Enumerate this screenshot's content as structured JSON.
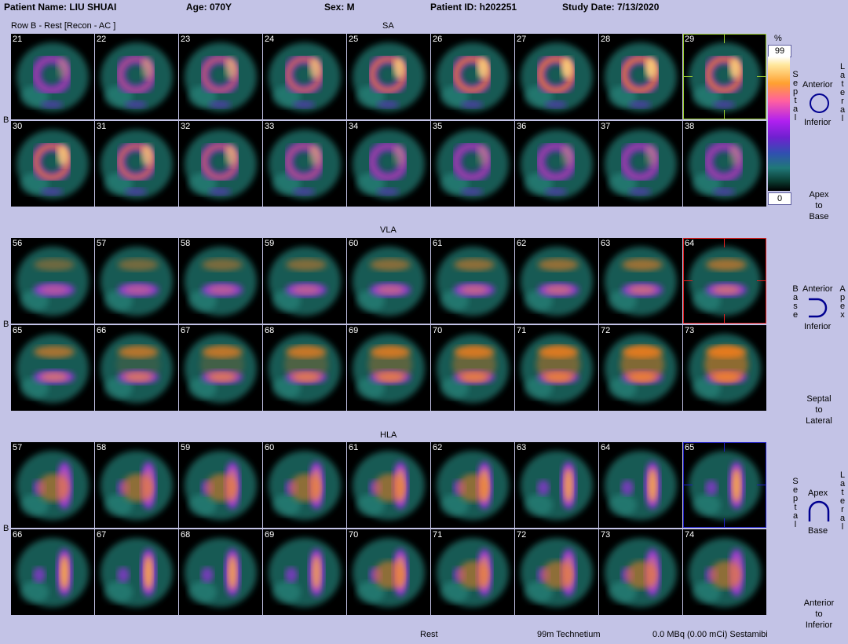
{
  "header": {
    "patient_name": "Patient Name: LIU SHUAI",
    "age": "Age: 070Y",
    "sex": "Sex: M",
    "patient_id": "Patient ID: h202251",
    "study_date": "Study Date: 7/13/2020"
  },
  "row_label": "Row B - Rest [Recon - AC ]",
  "side_label": "B",
  "sections": [
    {
      "title": "SA",
      "rows": [
        [
          "21",
          "22",
          "23",
          "24",
          "25",
          "26",
          "27",
          "28",
          "29"
        ],
        [
          "30",
          "31",
          "32",
          "33",
          "34",
          "35",
          "36",
          "37",
          "38"
        ]
      ]
    },
    {
      "title": "VLA",
      "rows": [
        [
          "56",
          "57",
          "58",
          "59",
          "60",
          "61",
          "62",
          "63",
          "64"
        ],
        [
          "65",
          "66",
          "67",
          "68",
          "69",
          "70",
          "71",
          "72",
          "73"
        ]
      ]
    },
    {
      "title": "HLA",
      "rows": [
        [
          "57",
          "58",
          "59",
          "60",
          "61",
          "62",
          "63",
          "64",
          "65"
        ],
        [
          "66",
          "67",
          "68",
          "69",
          "70",
          "71",
          "72",
          "73",
          "74"
        ]
      ]
    }
  ],
  "colorbar": {
    "unit": "%",
    "max": "99",
    "min": "0"
  },
  "legend": {
    "sa": {
      "left": "Septal",
      "right": "Lateral",
      "top": "Anterior",
      "bottom": "Inferior",
      "caption": [
        "Apex",
        "to",
        "Base"
      ]
    },
    "vla": {
      "left": "Base",
      "right": "Apex",
      "top": "Anterior",
      "bottom": "Inferior",
      "caption": [
        "Septal",
        "to",
        "Lateral"
      ]
    },
    "hla": {
      "left": "Septal",
      "right": "Lateral",
      "top": "Apex",
      "bottom": "Base",
      "caption": [
        "Anterior",
        "to",
        "Inferior"
      ]
    }
  },
  "footer": {
    "state": "Rest",
    "isotope": "99m Technetium",
    "dose": "0.0 MBq (0.00 mCi) Sestamibi"
  },
  "colors": {
    "background": "#c3c3e6",
    "sa_highlight": "#9acd32",
    "vla_highlight": "#e02020",
    "hla_highlight": "#2020c0"
  }
}
